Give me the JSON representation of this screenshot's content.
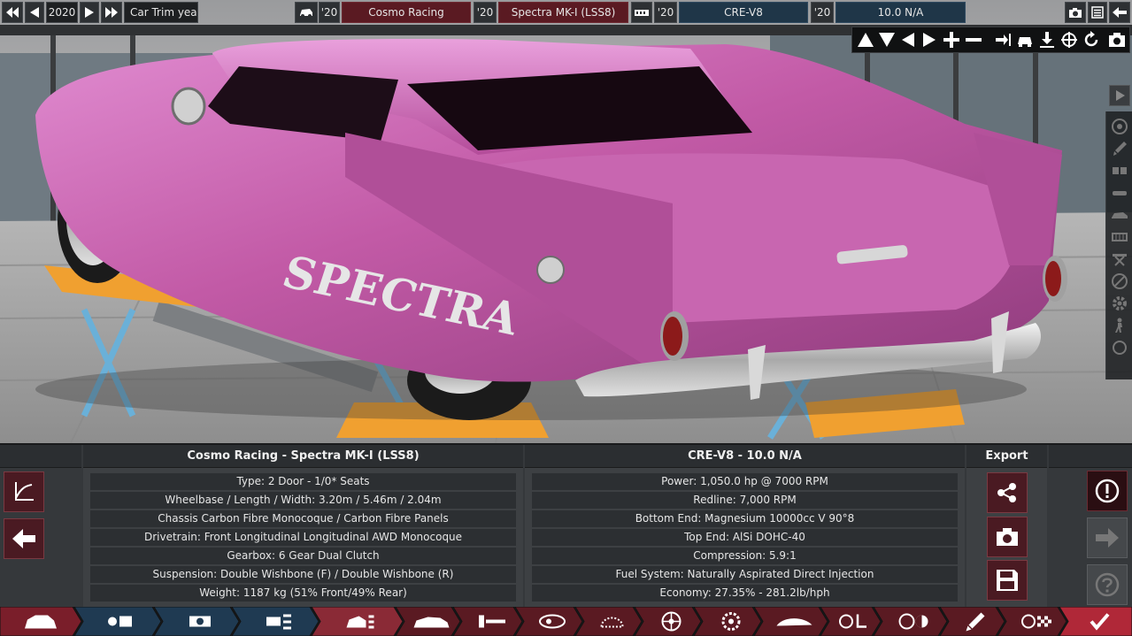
{
  "topbar": {
    "year": "2020",
    "year_label": "Car Trim year",
    "company_year": "'20",
    "company": "Cosmo Racing",
    "model_year": "'20",
    "model": "Spectra MK-I (LSS8)",
    "engine_year": "'20",
    "engine_family": "CRE-V8",
    "variant_year": "'20",
    "engine_variant": "10.0 N/A"
  },
  "car_info": {
    "title": "Cosmo Racing - Spectra MK-I (LSS8)",
    "rows": [
      "Type: 2 Door - 1/0* Seats",
      "Wheelbase / Length / Width: 3.20m / 5.46m / 2.04m",
      "Chassis Carbon Fibre Monocoque / Carbon Fibre Panels",
      "Drivetrain: Front Longitudinal Longitudinal AWD Monocoque",
      "Gearbox: 6 Gear Dual Clutch",
      "Suspension: Double Wishbone (F) / Double Wishbone (R)",
      "Weight: 1187 kg (51% Front/49% Rear)"
    ]
  },
  "engine_info": {
    "title": "CRE-V8 - 10.0 N/A",
    "rows": [
      "Power: 1,050.0 hp @ 7000 RPM",
      "Redline:  7,000 RPM",
      "Bottom End: Magnesium 10000cc V 90°8",
      "Top End: AlSi DOHC-40",
      "Compression: 5.9:1",
      "Fuel System: Naturally Aspirated Direct Injection",
      "Economy: 27.35% - 281.2lb/hph"
    ]
  },
  "export": {
    "title": "Export"
  },
  "car_badge": "SPECTRA",
  "colors": {
    "car_body": "#c25aa6",
    "accent_red": "#5a1a22",
    "accent_blue": "#1f3648",
    "lift_orange": "#f0a030",
    "lift_blue": "#6ab0d8"
  },
  "icons": {
    "tabs": [
      "car-icon",
      "company-icon",
      "engine-family-icon",
      "engine-variant-icon",
      "car-model-icon",
      "body-icon",
      "engine-bay-icon",
      "headlight-icon",
      "grille-icon",
      "wheel-icon",
      "brake-icon",
      "aero-icon",
      "interior-icon",
      "steering-icon",
      "tune-icon",
      "test-track-icon",
      "finish-icon"
    ]
  }
}
